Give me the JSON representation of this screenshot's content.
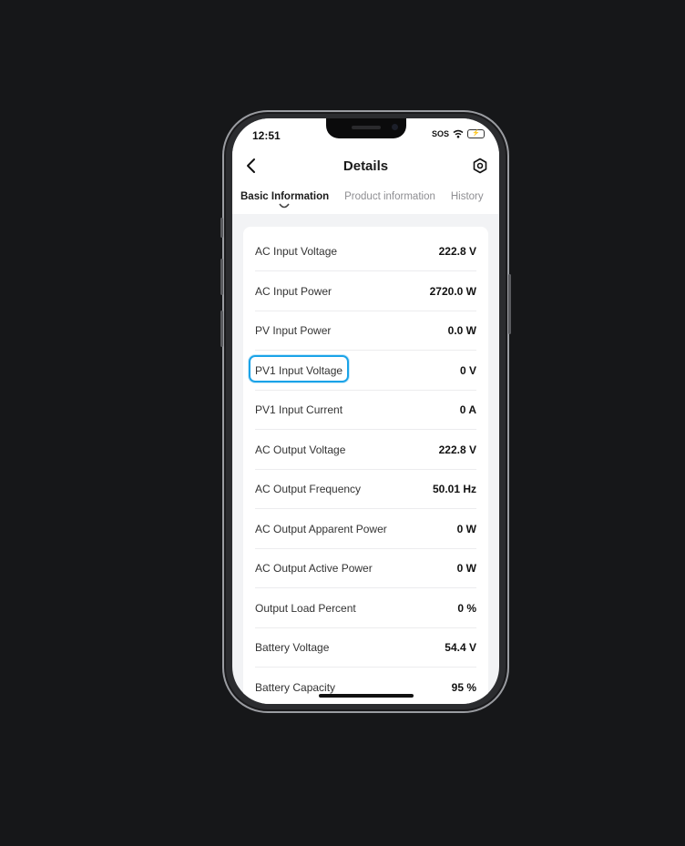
{
  "status": {
    "time": "12:51",
    "sos": "SOS",
    "battery_glyph": "⚡"
  },
  "header": {
    "title": "Details",
    "back_icon": "chevron-left-icon",
    "settings_icon": "hexagon-gear-icon"
  },
  "tabs": [
    {
      "label": "Basic Information",
      "active": true
    },
    {
      "label": "Product information",
      "active": false
    },
    {
      "label": "History",
      "active": false
    }
  ],
  "rows": [
    {
      "label": "AC Input Voltage",
      "value": "222.8 V"
    },
    {
      "label": "AC Input Power",
      "value": "2720.0 W"
    },
    {
      "label": "PV Input Power",
      "value": "0.0 W"
    },
    {
      "label": "PV1 Input Voltage",
      "value": "0 V"
    },
    {
      "label": "PV1 Input Current",
      "value": "0 A"
    },
    {
      "label": "AC Output Voltage",
      "value": "222.8 V"
    },
    {
      "label": "AC Output Frequency",
      "value": "50.01 Hz"
    },
    {
      "label": "AC Output Apparent Power",
      "value": "0 W"
    },
    {
      "label": "AC Output Active Power",
      "value": "0 W"
    },
    {
      "label": "Output Load Percent",
      "value": "0 %"
    },
    {
      "label": "Battery Voltage",
      "value": "54.4 V"
    },
    {
      "label": "Battery Capacity",
      "value": "95 %"
    }
  ],
  "colors": {
    "highlight": "#1aa3e8",
    "background": "#161719",
    "card": "#ffffff"
  }
}
